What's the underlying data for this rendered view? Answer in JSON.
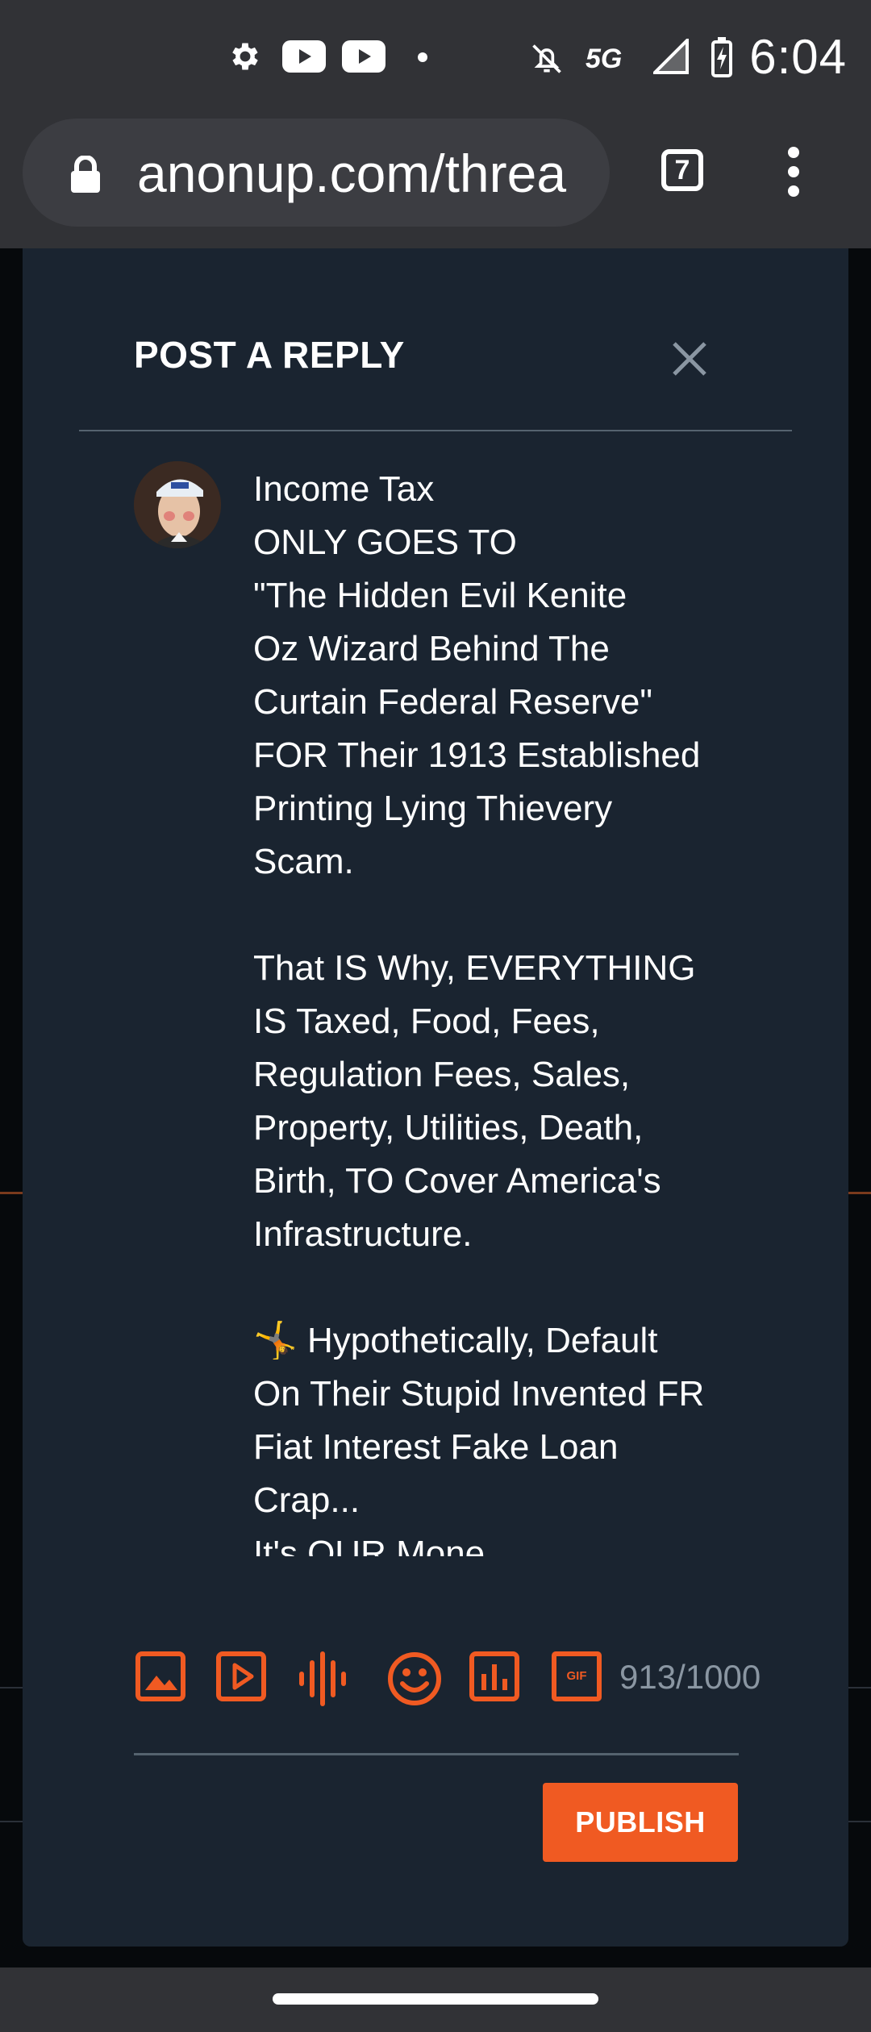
{
  "status_bar": {
    "time": "6:04",
    "network": "5G",
    "icons": [
      "gear-icon",
      "youtube-icon",
      "youtube-icon",
      "dot-icon",
      "bell-off-icon",
      "signal-icon",
      "battery-charging-icon"
    ]
  },
  "browser": {
    "url": "anonup.com/threa",
    "tab_count": "7"
  },
  "modal": {
    "title": "POST A REPLY",
    "reply_text": "Income Tax\nONLY GOES TO\n\"The Hidden Evil Kenite\nOz Wizard Behind The\nCurtain Federal Reserve\"\nFOR Their 1913 Established\nPrinting Lying Thievery\nScam.\n\nThat IS Why, EVERYTHING\nIS Taxed, Food, Fees,\nRegulation Fees, Sales,\nProperty, Utilities, Death,\nBirth, TO Cover America's\nInfrastructure.\n\n🤸 Hypothetically, Default\nOn Their Stupid Invented FR\nFiat Interest Fake Loan\nCrap...\nIt's OUR Mone",
    "tools": [
      "image-icon",
      "video-icon",
      "audio-icon",
      "emoji-icon",
      "poll-icon",
      "gif-icon"
    ],
    "gif_label": "GIF",
    "char_count": "913/1000",
    "publish_label": "PUBLISH"
  },
  "colors": {
    "accent": "#f05a22",
    "modal_bg": "#1a2430",
    "chrome_bg": "#313236"
  }
}
